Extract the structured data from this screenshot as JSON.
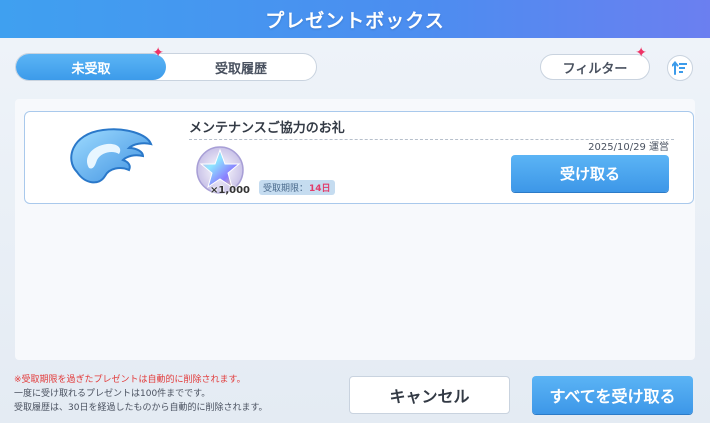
{
  "header": {
    "title": "プレゼントボックス"
  },
  "tabs": [
    {
      "label": "未受取",
      "active": true
    },
    {
      "label": "受取履歴",
      "active": false
    }
  ],
  "toolbar": {
    "filter_label": "フィルター",
    "sort_icon": "sort-icon"
  },
  "presents": [
    {
      "title": "メンテナンスご協力のお礼",
      "date": "2025/10/29",
      "sender": "運営",
      "quantity": "×1,000",
      "expiry_label": "受取期限：",
      "expiry_days": "14日",
      "receive_label": "受け取る",
      "icon": "wing-icon",
      "reward_icon": "star-gem-icon"
    }
  ],
  "notes": [
    "※受取期限を過ぎたプレゼントは自動的に削除されます。",
    "一度に受け取れるプレゼントは100件までです。",
    "受取履歴は、30日を経過したものから自動的に削除されます。"
  ],
  "footer": {
    "cancel_label": "キャンセル",
    "receive_all_label": "すべてを受け取る"
  },
  "colors": {
    "accent": "#3c9bea",
    "badge": "#ee3366",
    "note": "#e23c3c"
  }
}
